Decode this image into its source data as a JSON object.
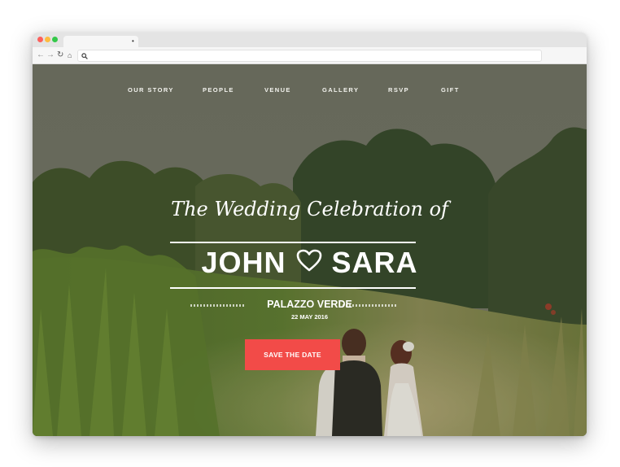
{
  "browser": {
    "tab_title": "•",
    "address": ""
  },
  "nav": {
    "items": [
      "OUR STORY",
      "PEOPLE",
      "VENUE",
      "GALLERY",
      "RSVP",
      "GIFT"
    ]
  },
  "hero": {
    "script_title": "The Wedding Celebration of",
    "name_left": "JOHN",
    "name_right": "SARA",
    "venue": "PALAZZO VERDE",
    "date": "22 MAY 2016",
    "cta_label": "SAVE THE DATE"
  },
  "colors": {
    "accent": "#f24b48",
    "hero_overlay": "#6c6e62",
    "text": "#ffffff"
  },
  "icons": [
    "back-icon",
    "forward-icon",
    "reload-icon",
    "home-icon",
    "search-icon",
    "heart-icon"
  ]
}
